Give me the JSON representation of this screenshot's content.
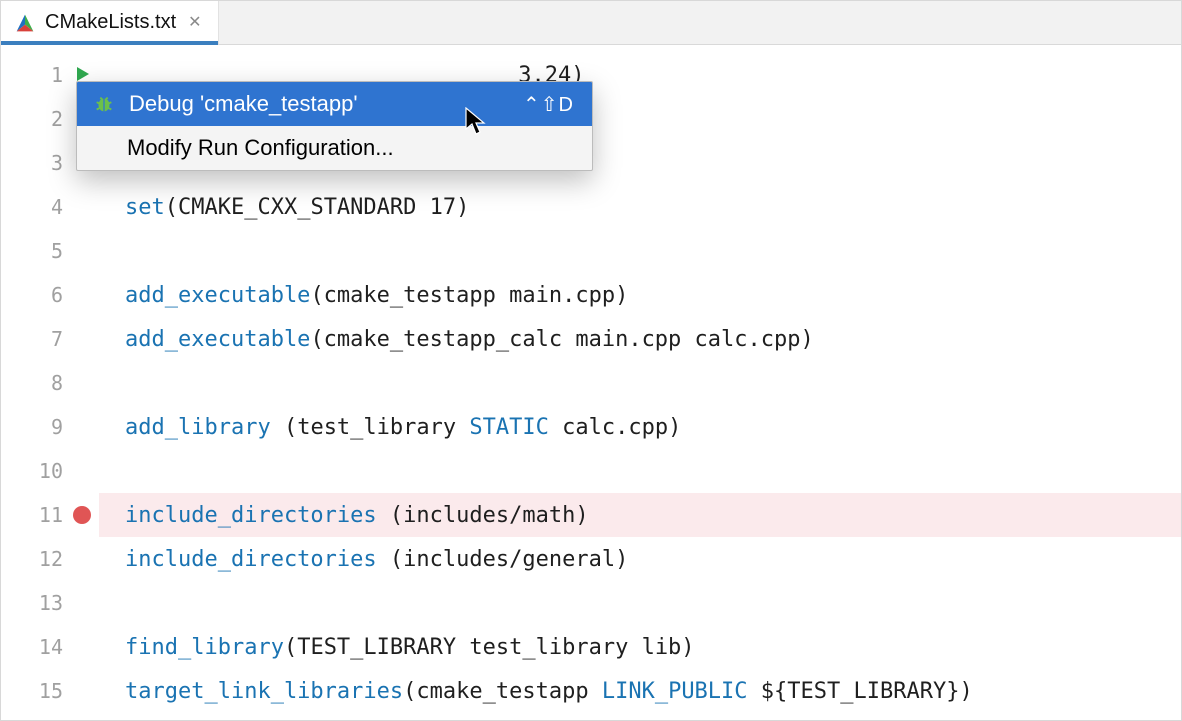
{
  "tab": {
    "title": "CMakeLists.txt"
  },
  "menu": {
    "debug_label": "Debug 'cmake_testapp'",
    "debug_shortcut": "⌃⇧D",
    "modify_label": "Modify Run Configuration..."
  },
  "gutter": {
    "lines": [
      "1",
      "2",
      "3",
      "4",
      "5",
      "6",
      "7",
      "8",
      "9",
      "10",
      "11",
      "12",
      "13",
      "14",
      "15"
    ],
    "run_icon_line": 1,
    "breakpoint_line": 11
  },
  "code": {
    "l1": {
      "tail": " 3.24)"
    },
    "l4": {
      "cmd": "set",
      "rest": "(CMAKE_CXX_STANDARD 17)"
    },
    "l6": {
      "cmd": "add_executable",
      "rest": "(cmake_testapp main.cpp)"
    },
    "l7": {
      "cmd": "add_executable",
      "rest": "(cmake_testapp_calc main.cpp calc.cpp)"
    },
    "l9": {
      "cmd": "add_library",
      "space": " ",
      "open": "(test_library ",
      "kw": "STATIC",
      "close": " calc.cpp)"
    },
    "l11": {
      "cmd": "include_directories",
      "space": " ",
      "rest": "(includes/math)"
    },
    "l12": {
      "cmd": "include_directories",
      "space": " ",
      "rest": "(includes/general)"
    },
    "l14": {
      "cmd": "find_library",
      "rest": "(TEST_LIBRARY test_library lib)"
    },
    "l15": {
      "cmd": "target_link_libraries",
      "open": "(cmake_testapp ",
      "kw": "LINK_PUBLIC",
      "mid": " ",
      "varopen": "${",
      "var": "TEST_LIBRARY",
      "varclose": "}",
      "close": ")"
    }
  }
}
